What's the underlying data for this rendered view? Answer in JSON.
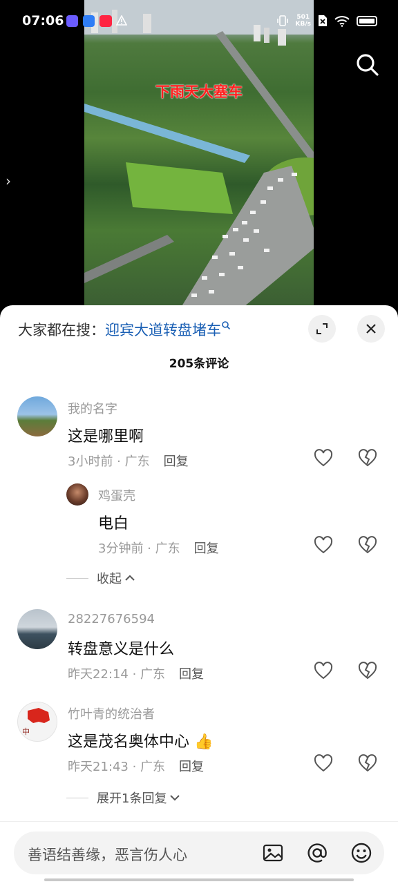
{
  "status_bar": {
    "time": "07:06",
    "net_speed_value": "501",
    "net_speed_unit": "KB/s",
    "notification_label": "小红书"
  },
  "video": {
    "title_overlay": "下雨天大塞车"
  },
  "sheet": {
    "search_prefix": "大家都在搜：",
    "search_keyword": "迎宾大道转盘堵车",
    "comment_count": "205条评论"
  },
  "comments": [
    {
      "name": "我的名字",
      "text": "这是哪里啊",
      "time": "3小时前 · 广东",
      "reply": "回复"
    },
    {
      "name": "鸡蛋壳",
      "text": "电白",
      "time": "3分钟前 · 广东",
      "reply": "回复"
    },
    {
      "name": "28227676594",
      "text": "转盘意义是什么",
      "time": "昨天22:14 · 广东",
      "reply": "回复"
    },
    {
      "name": "竹叶青的统治者",
      "text": "这是茂名奥体中心 👍",
      "time": "昨天21:43 · 广东",
      "reply": "回复"
    }
  ],
  "toggles": {
    "collapse": "收起",
    "expand": "展开1条回复"
  },
  "input": {
    "placeholder": "善语结善缘，恶言伤人心"
  },
  "colors": {
    "keyword": "#1a5fb4",
    "overlay_title": "#ff2020"
  }
}
